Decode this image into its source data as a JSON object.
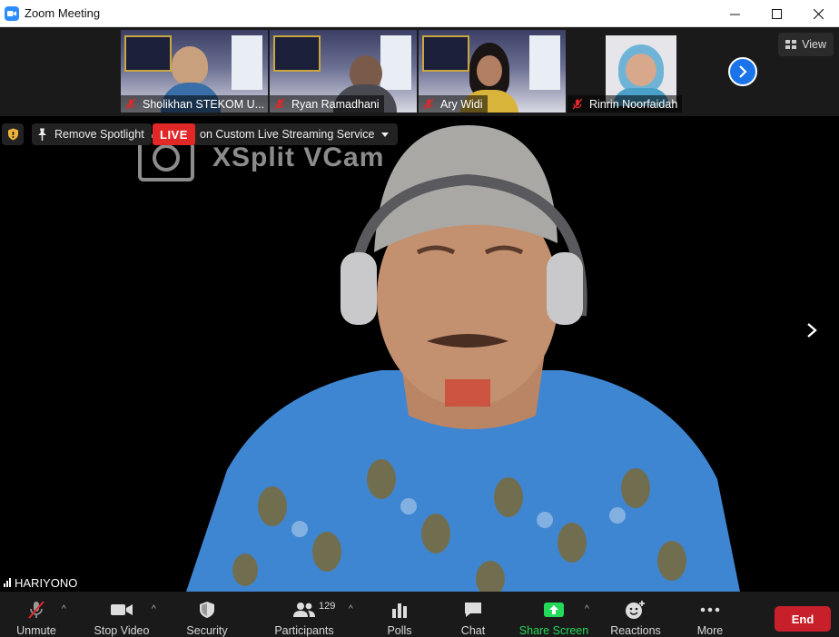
{
  "window": {
    "title": "Zoom Meeting",
    "controls": [
      "minimize-icon",
      "maximize-icon",
      "close-icon"
    ]
  },
  "gallery": {
    "view_label": "View",
    "participants": [
      {
        "name": "Sholikhan STEKOM U...",
        "muted": true
      },
      {
        "name": "Ryan Ramadhani",
        "muted": true
      },
      {
        "name": "Ary Widi",
        "muted": true
      },
      {
        "name": "Rinrin Noorfaidah",
        "muted": true
      }
    ]
  },
  "stage": {
    "remove_spotlight_label": "Remove Spotlight",
    "live_label": "LIVE",
    "live_target_label": "on Custom Live Streaming Service",
    "watermark_text": "XSplit VCam",
    "speaker_name": "HARIYONO"
  },
  "toolbar": {
    "unmute": "Unmute",
    "stop_video": "Stop Video",
    "security": "Security",
    "participants": "Participants",
    "participants_count": "129",
    "polls": "Polls",
    "chat": "Chat",
    "share_screen": "Share Screen",
    "reactions": "Reactions",
    "more": "More",
    "end": "End"
  },
  "colors": {
    "accent": "#2d8cff",
    "live": "#e02828",
    "share": "#23d959",
    "end": "#c8202a",
    "muted": "#e02828"
  }
}
